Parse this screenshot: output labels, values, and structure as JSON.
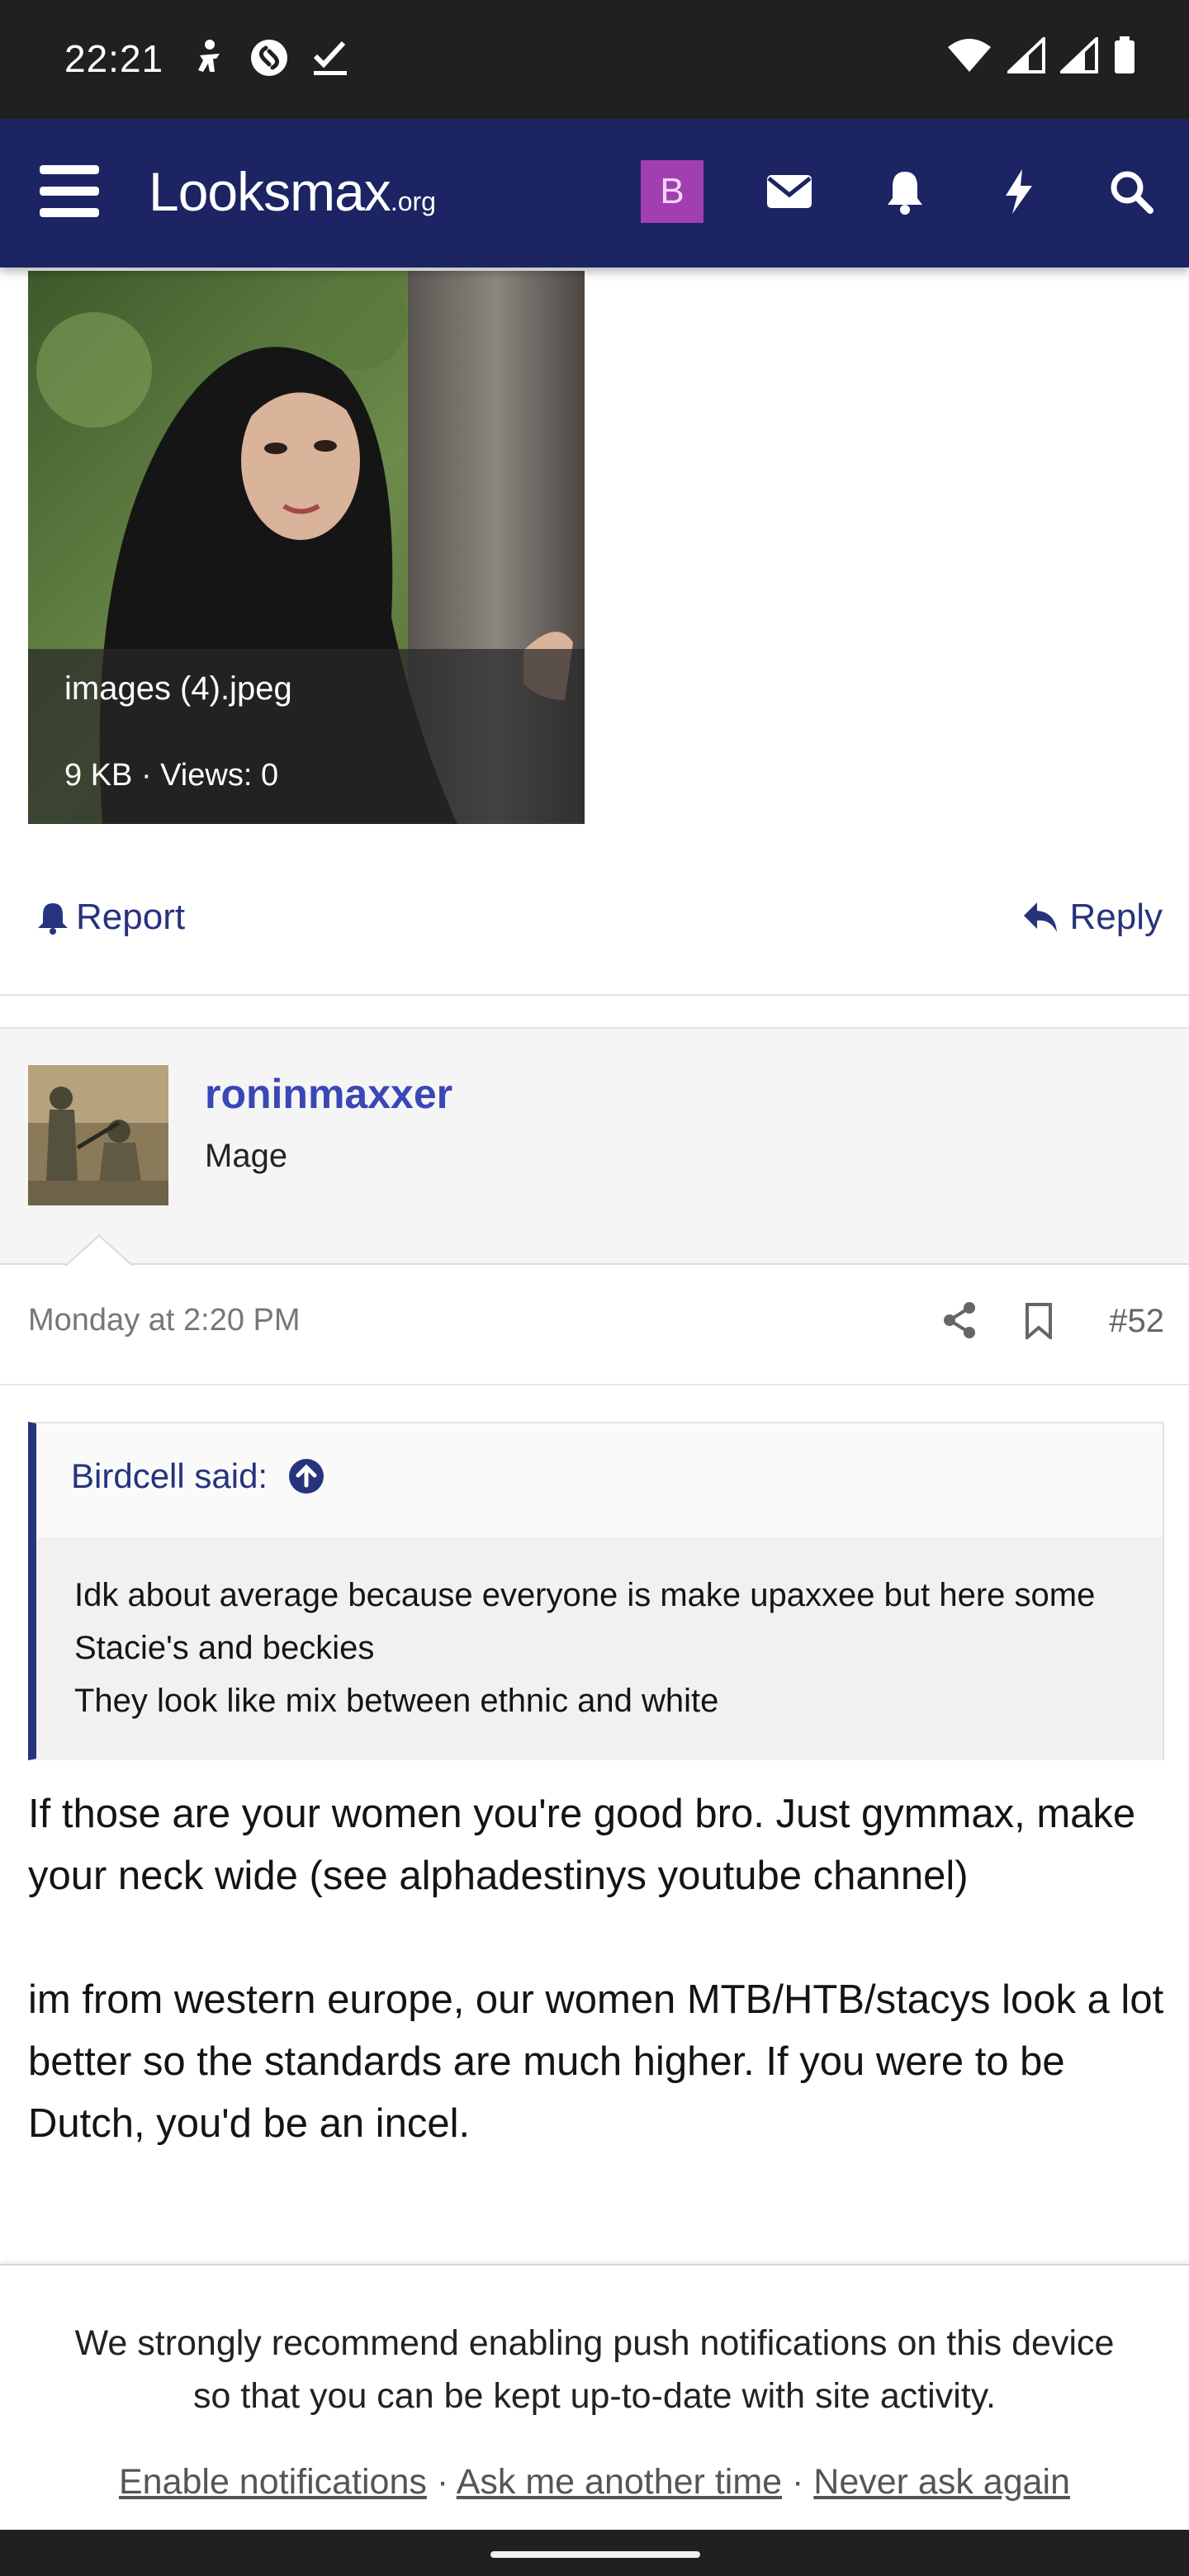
{
  "status_bar": {
    "time": "22:21",
    "left_icons": [
      "accessibility-icon",
      "shazam-icon",
      "check-icon"
    ],
    "right_icons": [
      "wifi-icon",
      "signal-icon",
      "signal-icon",
      "battery-icon"
    ]
  },
  "header": {
    "logo": "Looksmax",
    "logo_suffix": ".org",
    "avatar_letter": "B",
    "colors": {
      "bar": "#1c2463",
      "avatar": "#a13fb0"
    },
    "icons": [
      "menu-icon",
      "mail-icon",
      "bell-icon",
      "bolt-icon",
      "search-icon"
    ]
  },
  "attachment": {
    "filename": "images (4).jpeg",
    "meta": "9 KB · Views: 0"
  },
  "post_actions": {
    "report": "Report",
    "reply": "Reply"
  },
  "post": {
    "username": "roninmaxxer",
    "user_title": "Mage",
    "date": "Monday at 2:20 PM",
    "number": "#52",
    "quote": {
      "author": "Birdcell said:",
      "lines": [
        "Idk about average because everyone is make upaxxee but here some Stacie's and beckies",
        "They look like mix between ethnic and white"
      ]
    },
    "paragraphs": [
      "If those are your women you're good bro. Just gymmax, make your neck wide (see alphadestinys youtube channel)",
      "im from western europe, our women MTB/HTB/stacys look a lot better so the standards are much higher. If you were to be Dutch, you'd be an incel."
    ]
  },
  "notification_banner": {
    "text": "We strongly recommend enabling push notifications on this device so that you can be kept up-to-date with site activity.",
    "links": [
      "Enable notifications",
      "Ask me another time",
      "Never ask again"
    ],
    "separator": " · "
  }
}
